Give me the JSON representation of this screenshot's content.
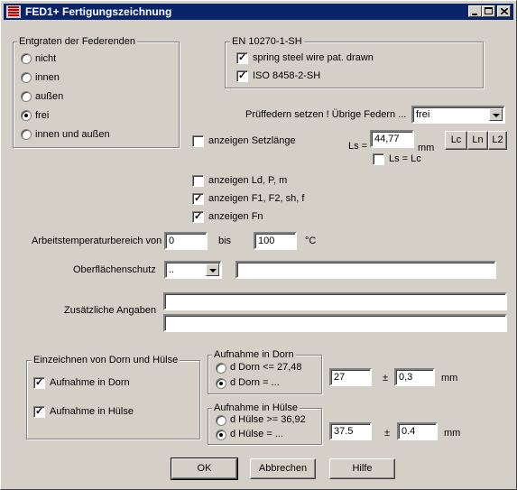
{
  "window": {
    "title": "FED1+ Fertigungszeichnung",
    "icon": "spring-icon"
  },
  "entgraten": {
    "label": "Entgraten der Federenden",
    "options": [
      "nicht",
      "innen",
      "außen",
      "frei",
      "innen und außen"
    ],
    "selected": "frei"
  },
  "norm": {
    "label": "EN 10270-1-SH",
    "checks": [
      {
        "label": "spring steel wire pat. drawn",
        "checked": true
      },
      {
        "label": "ISO 8458-2-SH",
        "checked": true
      }
    ]
  },
  "pruef": {
    "label": "Prüffedern setzen !  Übrige Federn ...",
    "value": "frei"
  },
  "setzlaenge": {
    "label": "anzeigen Setzlänge",
    "checked": false,
    "ls_label": "Ls =",
    "ls_value": "44,77",
    "ls_unit": "mm",
    "lsc_label": "Ls = Lc",
    "lsc_checked": false,
    "buttons": [
      "Lc",
      "Ln",
      "L2"
    ]
  },
  "anzeigen": [
    {
      "label": "anzeigen Ld, P, m",
      "checked": false
    },
    {
      "label": "anzeigen F1, F2, sh, f",
      "checked": true
    },
    {
      "label": "anzeigen Fn",
      "checked": true
    }
  ],
  "temp": {
    "label": "Arbeitstemperaturbereich von",
    "from": "0",
    "bis": "bis",
    "to": "100",
    "unit": "°C"
  },
  "oberflaeche": {
    "label": "Oberflächenschutz",
    "select": "..",
    "text": ""
  },
  "zusatz": {
    "label": "Zusätzliche Angaben",
    "line1": "",
    "line2": ""
  },
  "dorn_huelse": {
    "label": "Einzeichnen von Dorn und Hülse",
    "checks": [
      {
        "label": "Aufnahme in Dorn",
        "checked": true
      },
      {
        "label": "Aufnahme in Hülse",
        "checked": true
      }
    ]
  },
  "aufnahme_dorn": {
    "label": "Aufnahme in Dorn",
    "options": [
      "d Dorn <= 27,48",
      "d Dorn = ..."
    ],
    "selected": "d Dorn = ...",
    "value": "27",
    "pm": "±",
    "tol": "0,3",
    "unit": "mm"
  },
  "aufnahme_huelse": {
    "label": "Aufnahme in Hülse",
    "options": [
      "d Hülse >= 36,92",
      "d Hülse = ..."
    ],
    "selected": "d Hülse = ...",
    "value": "37.5",
    "pm": "±",
    "tol": "0.4",
    "unit": "mm"
  },
  "buttons": {
    "ok": "OK",
    "cancel": "Abbrechen",
    "help": "Hilfe"
  }
}
